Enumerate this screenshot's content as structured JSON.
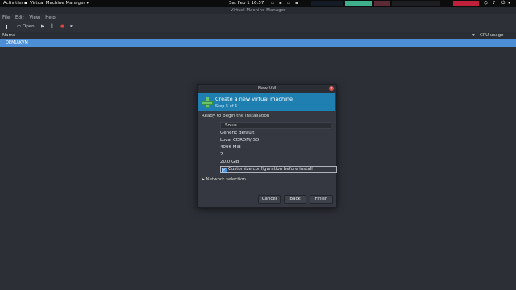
{
  "topbar": {
    "activities": "Activities",
    "app_menu": "Virtual Machine Manager",
    "clock": "Sat Feb 1  16:57"
  },
  "window": {
    "title": "Virtual Machine Manager",
    "menu": [
      "File",
      "Edit",
      "View",
      "Help"
    ],
    "toolbar": {
      "open_label": "Open"
    },
    "list": {
      "col_name": "Name",
      "col_cpu": "CPU usage",
      "vm_row": "QEMU/KVM"
    }
  },
  "dialog": {
    "title": "New VM",
    "header_title": "Create a new virtual machine",
    "step": "Step 5 of 5",
    "ready_text": "Ready to begin the installation",
    "name_value": "Solus",
    "rows": [
      {
        "value": "Generic default"
      },
      {
        "value": "Local CDROM/ISO"
      },
      {
        "value": "4096 MiB"
      },
      {
        "value": "2"
      },
      {
        "value": "20.0 GiB"
      }
    ],
    "customize_label": "Customize configuration before install",
    "customize_checked": true,
    "network_expander": "Network selection",
    "buttons": {
      "cancel": "Cancel",
      "back": "Back",
      "finish": "Finish"
    }
  },
  "colors": {
    "accent": "#4d8fd6",
    "banner": "#1e7fb0",
    "close": "#d9534f"
  }
}
